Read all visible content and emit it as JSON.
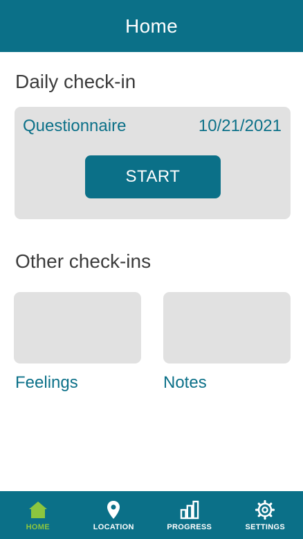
{
  "header": {
    "title": "Home"
  },
  "daily": {
    "section_title": "Daily check-in",
    "card": {
      "name": "Questionnaire",
      "date": "10/21/2021",
      "button_label": "START"
    }
  },
  "other": {
    "section_title": "Other check-ins",
    "items": [
      {
        "label": "Feelings"
      },
      {
        "label": "Notes"
      }
    ]
  },
  "nav": {
    "items": [
      {
        "label": "HOME",
        "icon": "home-icon",
        "active": true
      },
      {
        "label": "LOCATION",
        "icon": "location-pin-icon",
        "active": false
      },
      {
        "label": "PROGRESS",
        "icon": "bar-chart-icon",
        "active": false
      },
      {
        "label": "SETTINGS",
        "icon": "gear-icon",
        "active": false
      }
    ]
  },
  "colors": {
    "primary": "#0b7088",
    "active_nav": "#8cc63f",
    "card_background": "#e1e1e1",
    "heading_text": "#3b3b3b"
  }
}
